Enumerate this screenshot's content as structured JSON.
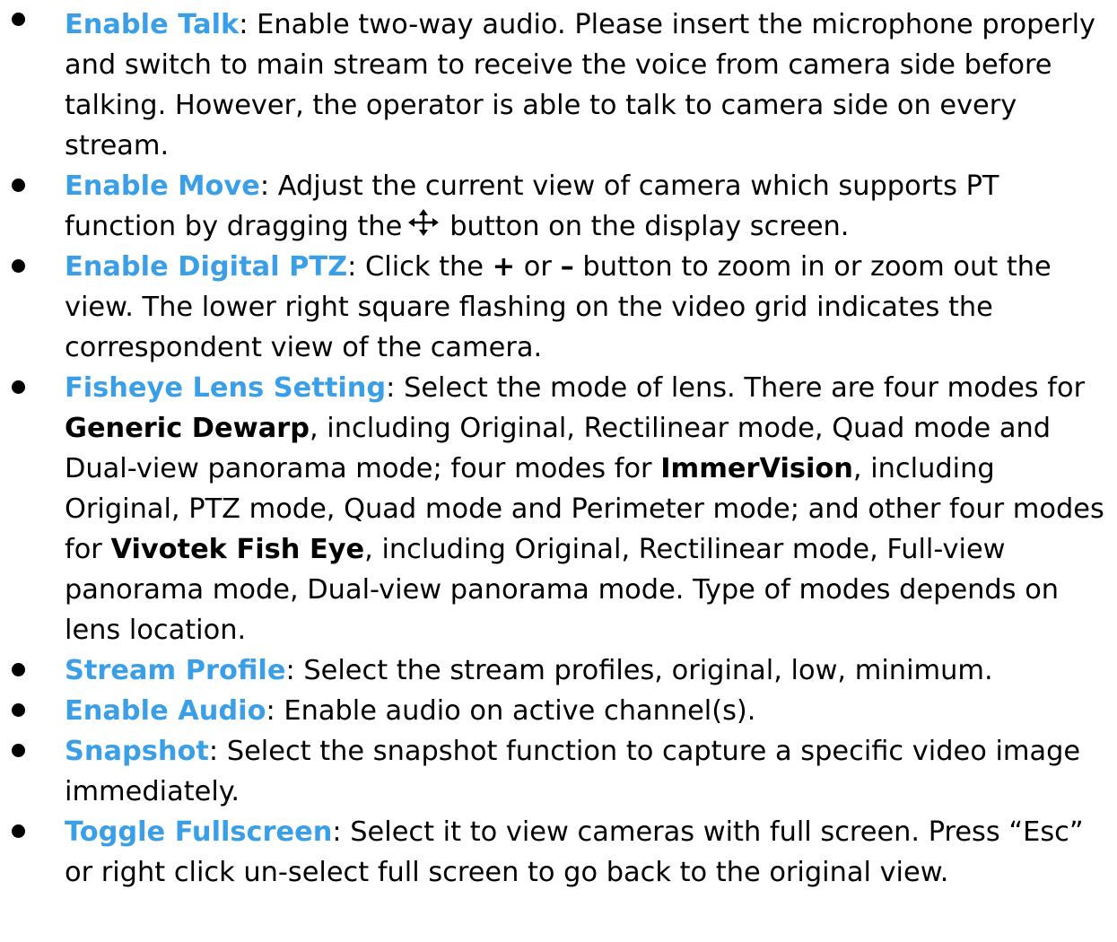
{
  "items": [
    {
      "term": "Enable Talk",
      "text": ": Enable two-way audio. Please insert the microphone properly and switch to main stream to receive the voice from camera side before talking. However, the operator is able to talk to camera side on every stream."
    },
    {
      "term": "Enable Move",
      "text_before_icon": ": Adjust the current view of camera which supports PT function by dragging the",
      "icon": "move-arrows-icon",
      "text_after_icon": "button on the display screen."
    },
    {
      "term": "Enable Digital PTZ",
      "text_1": ": Click the ",
      "plus": "+",
      "text_2": " or ",
      "minus": "–",
      "text_3": " button to zoom in or zoom out the view. The lower right square flashing on the video grid indicates the correspondent view of the camera."
    },
    {
      "term": "Fisheye Lens Setting",
      "text_1": ": Select the mode of lens. There are four modes for ",
      "bold_1": "Generic Dewarp",
      "text_2": ", including Original, Rectilinear mode, Quad mode and Dual-view panorama mode; four modes for ",
      "bold_2": "ImmerVision",
      "text_3": ", including Original, PTZ mode, Quad mode and Perimeter mode; and other four modes for ",
      "bold_3": "Vivotek Fish Eye",
      "text_4": ", including Original, Rectilinear mode, Full-view panorama mode, Dual-view panorama mode. Type of modes depends on lens location."
    },
    {
      "term": "Stream Profile",
      "text": ": Select the stream profiles, original, low, minimum."
    },
    {
      "term": "Enable Audio",
      "text": ": Enable audio on active channel(s)."
    },
    {
      "term": "Snapshot",
      "text": ": Select the snapshot function to capture a specific video image immediately."
    },
    {
      "term": "Toggle Fullscreen",
      "text": ": Select it to view cameras with full screen. Press “Esc” or right click un-select full screen to go back to the original view."
    }
  ],
  "colors": {
    "term": "#3a9fe6",
    "text": "#000000",
    "bullet": "#000000"
  }
}
